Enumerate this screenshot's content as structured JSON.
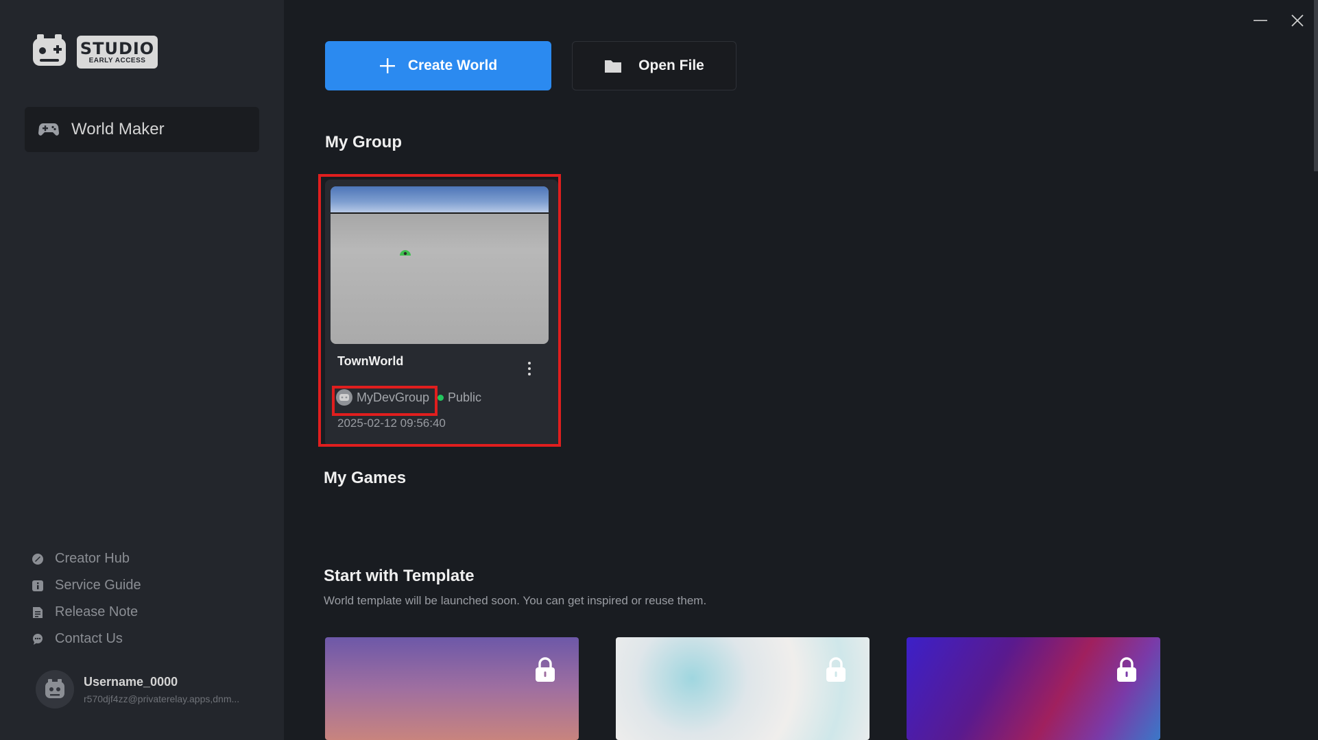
{
  "sidebar": {
    "logo": {
      "title": "STUDIO",
      "subtitle": "EARLY ACCESS"
    },
    "main_nav": {
      "label": "World Maker",
      "icon": "gamepad-icon"
    },
    "links": [
      {
        "label": "Creator Hub",
        "icon": "creator-hub-icon"
      },
      {
        "label": "Service Guide",
        "icon": "info-icon"
      },
      {
        "label": "Release Note",
        "icon": "document-icon"
      },
      {
        "label": "Contact Us",
        "icon": "chat-icon"
      }
    ],
    "user": {
      "name": "Username_0000",
      "email": "r570djf4zz@privaterelay.apps,dnm..."
    }
  },
  "toolbar": {
    "create_label": "Create World",
    "open_label": "Open File"
  },
  "sections": {
    "my_group": "My Group",
    "my_games": "My Games",
    "template": "Start with Template",
    "template_sub": "World template will be launched soon. You can get inspired or reuse them."
  },
  "world_card": {
    "title": "TownWorld",
    "group": "MyDevGroup",
    "visibility": "Public",
    "date": "2025-02-12 09:56:40"
  },
  "colors": {
    "accent": "#2b8af0",
    "highlight": "#e01e1e",
    "status_public": "#22c55e"
  }
}
